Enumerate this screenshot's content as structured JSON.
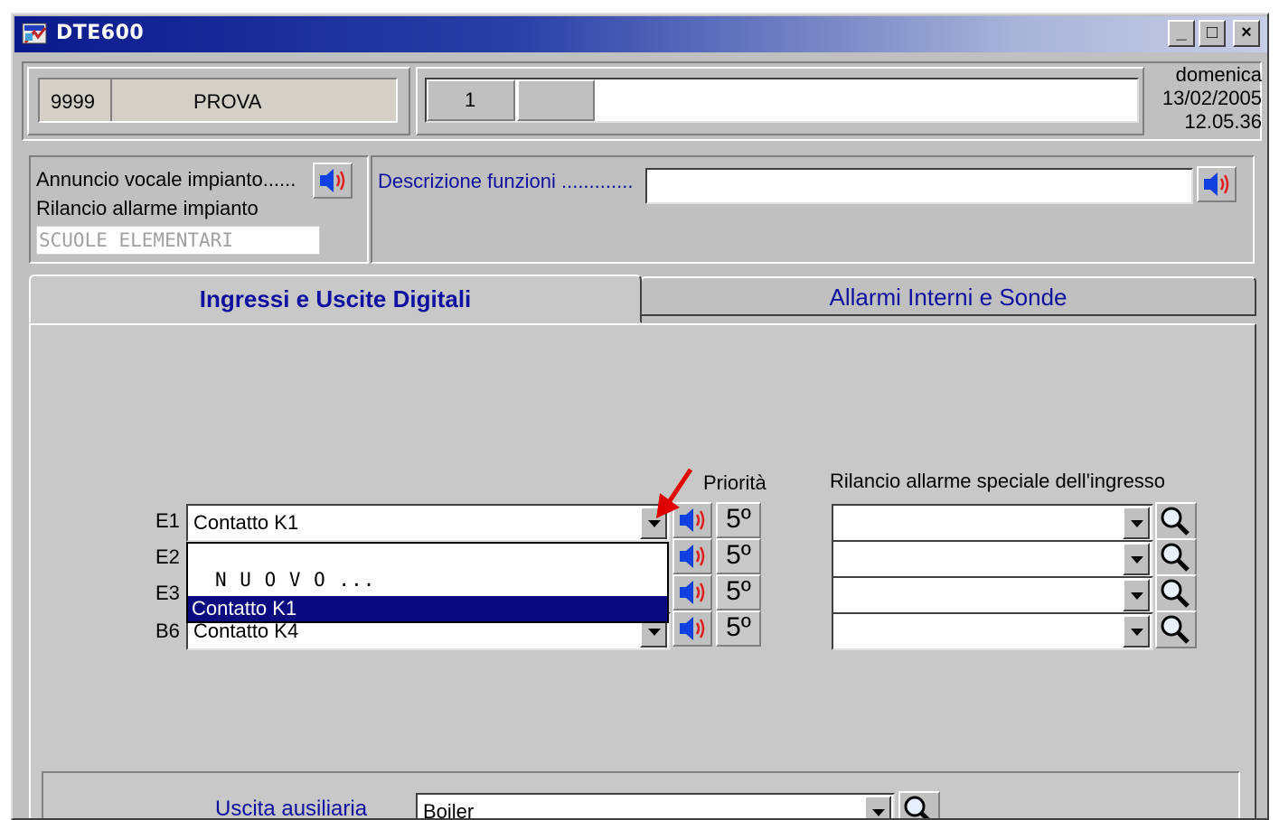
{
  "window": {
    "title": "DTE600",
    "min": "_",
    "max": "□",
    "close": "×"
  },
  "header": {
    "code": "9999",
    "name": "PROVA",
    "number": "1",
    "segment2": "",
    "description": "",
    "day": "domenica",
    "date": "13/02/2005",
    "time": "12.05.36"
  },
  "info": {
    "voice_label": "Annuncio vocale impianto......",
    "alarm_label": "Rilancio allarme impianto",
    "plant_name": "SCUOLE ELEMENTARI",
    "functions_label": "Descrizione funzioni .............",
    "functions_value": ""
  },
  "tabs": [
    {
      "label": "Ingressi e Uscite Digitali",
      "active": true
    },
    {
      "label": "Allarmi Interni e Sonde",
      "active": false
    }
  ],
  "inputs": {
    "priority_header": "Priorità",
    "special_header": "Rilancio allarme speciale dell'ingresso",
    "rows": [
      {
        "code": "E1",
        "value": "Contatto K1",
        "priority": "5º",
        "special": ""
      },
      {
        "code": "E2",
        "value": "",
        "priority": "5º",
        "special": ""
      },
      {
        "code": "E3",
        "value": "",
        "priority": "5º",
        "special": ""
      },
      {
        "code": "B6",
        "value": "Contatto K4",
        "priority": "5º",
        "special": ""
      }
    ],
    "dropdown_options": [
      {
        "label": "N U O V O ...",
        "selected": false
      },
      {
        "label": "Contatto K1",
        "selected": true
      }
    ]
  },
  "aux": {
    "label": "Uscita ausiliaria",
    "value": "Boiler"
  },
  "icons": {
    "speaker": "speaker-icon",
    "magnifier": "magnifier-icon",
    "arrow": "red-pointer-arrow-icon",
    "app": "app-icon"
  },
  "colors": {
    "title_start": "#0a1a8c",
    "selection": "#0a0a80",
    "tab_text": "#1010a0",
    "arrow": "#e00000"
  }
}
